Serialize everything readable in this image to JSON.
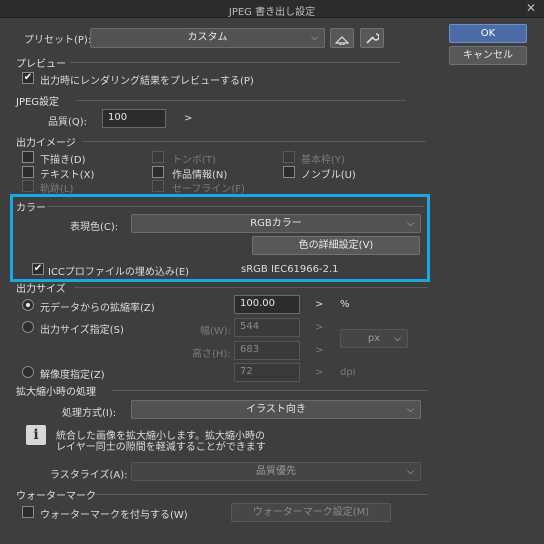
{
  "window": {
    "title": "JPEG 書き出し設定",
    "close_glyph": "✕"
  },
  "preset": {
    "label": "プリセット(P):",
    "value": "カスタム"
  },
  "buttons": {
    "ok": "OK",
    "cancel": "キャンセル"
  },
  "preview": {
    "section": "プレビュー",
    "checkbox_label": "出力時にレンダリング結果をプレビューする(P)",
    "checked": true
  },
  "jpeg": {
    "section": "JPEG設定",
    "quality_label": "品質(Q):",
    "quality_value": "100",
    "quality_arrow": ">"
  },
  "output_image": {
    "section": "出力イメージ",
    "items": [
      {
        "label": "下描き(D)",
        "checked": false,
        "enabled": true
      },
      {
        "label": "トンボ(T)",
        "checked": false,
        "enabled": false
      },
      {
        "label": "基本枠(Y)",
        "checked": false,
        "enabled": false
      },
      {
        "label": "テキスト(X)",
        "checked": false,
        "enabled": true
      },
      {
        "label": "作品情報(N)",
        "checked": false,
        "enabled": true
      },
      {
        "label": "ノンブル(U)",
        "checked": false,
        "enabled": true
      },
      {
        "label": "軌跡(L)",
        "checked": false,
        "enabled": false
      },
      {
        "label": "セーフライン(F)",
        "checked": false,
        "enabled": false
      }
    ]
  },
  "color": {
    "section": "カラー",
    "expression_label": "表現色(C):",
    "expression_value": "RGBカラー",
    "detail_button": "色の詳細設定(V)",
    "icc_label": "ICCプロファイルの埋め込み(E)",
    "icc_checked": true,
    "icc_profile": "sRGB IEC61966-2.1",
    "highlight_color": "#19a9e0"
  },
  "output_size": {
    "section": "出力サイズ",
    "scale_label": "元データからの拡縮率(Z)",
    "scale_value": "100.00",
    "scale_arrow": ">",
    "scale_unit": "%",
    "size_label": "出力サイズ指定(S)",
    "width_label": "幅(W):",
    "width_value": "544",
    "height_label": "高さ(H):",
    "height_value": "683",
    "size_arrow": ">",
    "unit_value": "px",
    "resolution_label": "解像度指定(Z)",
    "resolution_value": "72",
    "resolution_arrow": ">",
    "resolution_unit": "dpi"
  },
  "scaling": {
    "section": "拡大縮小時の処理",
    "method_label": "処理方式(I):",
    "method_value": "イラスト向き",
    "info_glyph": "i",
    "info_line1": "統合した画像を拡大縮小します。拡大縮小時の",
    "info_line2": "レイヤー同士の隙間を軽減することができます",
    "rasterize_label": "ラスタライズ(A):",
    "rasterize_value": "品質優先"
  },
  "watermark": {
    "section": "ウォーターマーク",
    "checkbox_label": "ウォーターマークを付与する(W)",
    "settings_button": "ウォーターマーク設定(M)"
  },
  "icons": {
    "chevron": "⌵"
  }
}
